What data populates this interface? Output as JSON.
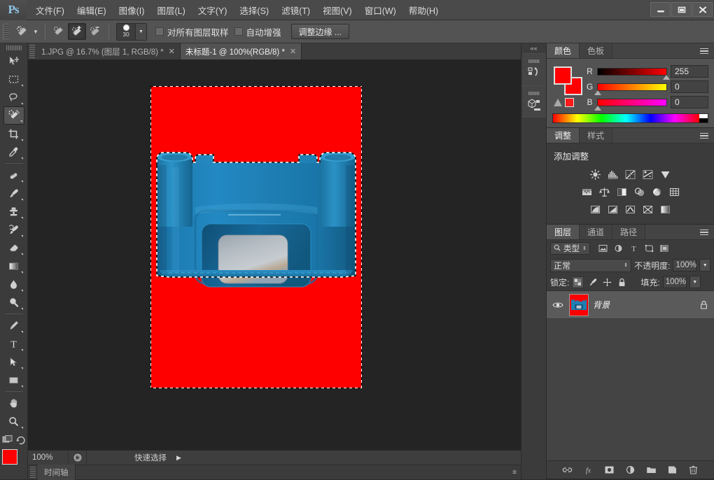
{
  "app": {
    "logo": "Ps",
    "menus": [
      {
        "label": "文件(F)"
      },
      {
        "label": "编辑(E)"
      },
      {
        "label": "图像(I)"
      },
      {
        "label": "图层(L)"
      },
      {
        "label": "文字(Y)"
      },
      {
        "label": "选择(S)"
      },
      {
        "label": "滤镜(T)"
      },
      {
        "label": "视图(V)"
      },
      {
        "label": "窗口(W)"
      },
      {
        "label": "帮助(H)"
      }
    ],
    "window_controls": {
      "minimize": "minimize-icon",
      "maximize": "maximize-icon",
      "close": "close-icon"
    }
  },
  "options_bar": {
    "brush_size": "30",
    "sample_all_layers_label": "对所有图层取样",
    "auto_enhance_label": "自动增强",
    "refine_edge_label": "调整边缘 ...",
    "modes": [
      "new-selection",
      "add-to-selection",
      "subtract-from-selection"
    ],
    "active_mode_index": 1
  },
  "tabs": [
    {
      "title": "1.JPG @ 16.7% (图层 1, RGB/8) *",
      "active": false,
      "close": "✕"
    },
    {
      "title": "未标题-1 @ 100%(RGB/8) *",
      "active": true,
      "close": "✕"
    }
  ],
  "tools": [
    {
      "name": "move-tool",
      "active": false
    },
    {
      "name": "marquee-tool",
      "active": false
    },
    {
      "name": "lasso-tool",
      "active": false
    },
    {
      "name": "quick-selection-tool",
      "active": true
    },
    {
      "name": "crop-tool",
      "active": false
    },
    {
      "name": "eyedropper-tool",
      "active": false
    },
    {
      "name": "healing-brush-tool",
      "active": false
    },
    {
      "name": "brush-tool",
      "active": false
    },
    {
      "name": "clone-stamp-tool",
      "active": false
    },
    {
      "name": "history-brush-tool",
      "active": false
    },
    {
      "name": "eraser-tool",
      "active": false
    },
    {
      "name": "gradient-tool",
      "active": false
    },
    {
      "name": "blur-tool",
      "active": false
    },
    {
      "name": "dodge-tool",
      "active": false
    },
    {
      "name": "pen-tool",
      "active": false
    },
    {
      "name": "type-tool",
      "active": false
    },
    {
      "name": "path-selection-tool",
      "active": false
    },
    {
      "name": "shape-tool",
      "active": false
    },
    {
      "name": "hand-tool",
      "active": false
    },
    {
      "name": "zoom-tool",
      "active": false
    }
  ],
  "swatches": {
    "foreground": "#fe0000",
    "background": "#fe0000"
  },
  "canvas": {
    "background_color": "#fe0000",
    "object_color": "#1c7fb8",
    "selection": "marching-ants"
  },
  "status_bar": {
    "zoom": "100%",
    "tool_hint": "快速选择",
    "arrow": "▶"
  },
  "timeline": {
    "tab_label": "时间轴"
  },
  "color_panel": {
    "tabs": [
      {
        "label": "颜色",
        "active": true
      },
      {
        "label": "色板",
        "active": false
      }
    ],
    "channels": [
      {
        "label": "R",
        "value": "255",
        "knob_pct": 100
      },
      {
        "label": "G",
        "value": "0",
        "knob_pct": 0
      },
      {
        "label": "B",
        "value": "0",
        "knob_pct": 0
      }
    ],
    "foreground": "#fe0000",
    "background": "#fe0000",
    "gamut_warning_color": "#ff1a1a"
  },
  "adjustments_panel": {
    "tabs": [
      {
        "label": "调整",
        "active": true
      },
      {
        "label": "样式",
        "active": false
      }
    ],
    "title": "添加调整",
    "rows": [
      [
        "brightness-contrast-icon",
        "levels-icon",
        "curves-icon",
        "exposure-icon",
        "vibrance-icon"
      ],
      [
        "hue-saturation-icon",
        "color-balance-icon",
        "black-white-icon",
        "photo-filter-icon",
        "channel-mixer-icon",
        "color-lookup-icon"
      ],
      [
        "invert-icon",
        "posterize-icon",
        "threshold-icon",
        "selective-color-icon",
        "gradient-map-icon"
      ]
    ]
  },
  "layers_panel": {
    "tabs": [
      {
        "label": "图层",
        "active": true
      },
      {
        "label": "通道",
        "active": false
      },
      {
        "label": "路径",
        "active": false
      }
    ],
    "filter": {
      "search_icon": "search-icon",
      "type_label": "类型",
      "icons": [
        "filter-pixel-icon",
        "filter-adjustment-icon",
        "filter-type-icon",
        "filter-shape-icon",
        "filter-smart-icon"
      ]
    },
    "blend_mode": "正常",
    "opacity_label": "不透明度:",
    "opacity_value": "100%",
    "lock_label": "锁定:",
    "lock_icons": [
      "lock-transparent-icon",
      "lock-image-icon",
      "lock-position-icon",
      "lock-all-icon"
    ],
    "fill_label": "填充:",
    "fill_value": "100%",
    "layers": [
      {
        "name": "背景",
        "visible": true,
        "locked": true,
        "selected": true,
        "visibility_icon": "eye-icon",
        "lock_icon": "lock-icon"
      }
    ],
    "footer_icons": [
      "link-layers-icon",
      "layer-style-fx-icon",
      "layer-mask-icon",
      "adjustment-layer-icon",
      "new-group-icon",
      "new-layer-icon",
      "delete-layer-icon"
    ]
  },
  "mini_dock": {
    "collapse_arrows": "««",
    "buttons": [
      "history-panel-icon",
      "mini-bridge-panel-icon"
    ]
  }
}
